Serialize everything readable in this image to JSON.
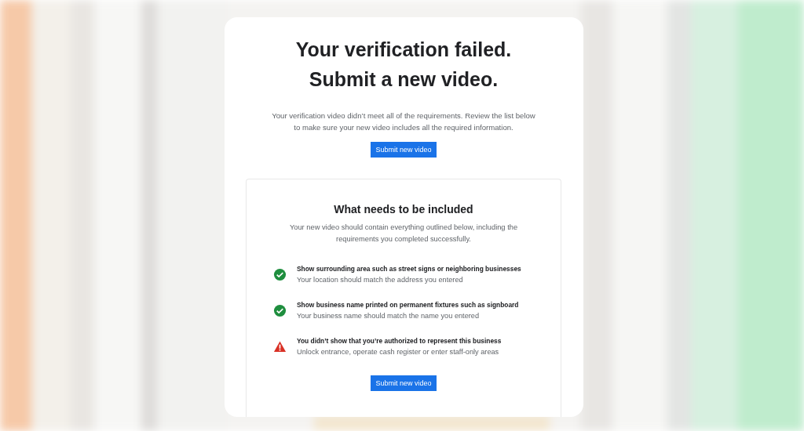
{
  "header": {
    "title_lines": [
      "Your verification failed.",
      "Submit a new video."
    ],
    "description": "Your verification video didn’t meet all of the requirements. Review the list below to make sure your new video includes all the required information.",
    "button": "Submit new video"
  },
  "requirements": {
    "title": "What needs to be included",
    "description": "Your new video should contain everything outlined below, including the requirements you completed successfully.",
    "items": [
      {
        "kind": "success",
        "title": "Show surrounding area such as street signs or neighboring businesses",
        "detail": "Your location should match the address you entered"
      },
      {
        "kind": "success",
        "title": "Show business name printed on permanent fixtures such as signboard",
        "detail": "Your business name should match the name you entered"
      },
      {
        "kind": "warning",
        "title": "You didn’t show that you’re authorized to represent this business",
        "detail": "Unlock entrance, operate cash register or enter staff-only areas"
      }
    ],
    "button": "Submit new video"
  }
}
